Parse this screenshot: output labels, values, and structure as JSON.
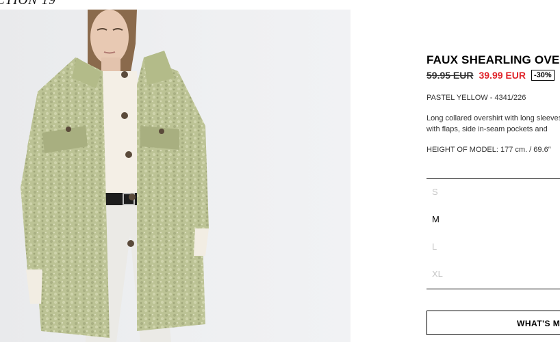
{
  "banner": {
    "text": "CTION 19"
  },
  "product": {
    "title": "FAUX SHEARLING OVERSHIRT",
    "old_price": "59.95 EUR",
    "new_price": "39.99 EUR",
    "discount": "-30%",
    "color_ref": "PASTEL YELLOW - 4341/226",
    "description_line1": "Long collared overshirt with long sleeves",
    "description_line2": "with flaps, side in-seam pockets and",
    "model_height": "HEIGHT OF MODEL: 177 cm. / 69.6″"
  },
  "sizes": [
    {
      "label": "S",
      "available": false
    },
    {
      "label": "M",
      "available": true
    },
    {
      "label": "L",
      "available": false
    },
    {
      "label": "XL",
      "available": false
    }
  ],
  "cta": {
    "label": "WHAT'S MY SIZE?"
  },
  "colors": {
    "sale_red": "#e0252b",
    "unavailable_grey": "#c8c8c8",
    "jacket_green": "#bdc496"
  }
}
